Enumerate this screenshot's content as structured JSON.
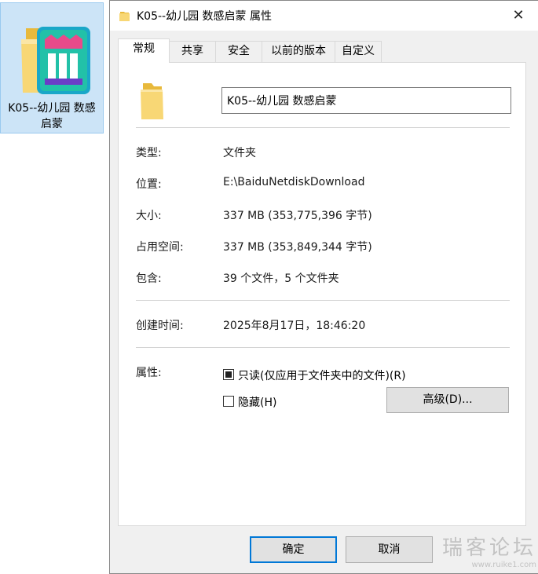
{
  "desktop_icon": {
    "label": "K05--幼儿园 数感启蒙"
  },
  "dialog": {
    "title": "K05--幼儿园 数感启蒙 属性",
    "close_glyph": "✕",
    "tabs": [
      {
        "label": "常规",
        "active": true
      },
      {
        "label": "共享",
        "active": false
      },
      {
        "label": "安全",
        "active": false
      },
      {
        "label": "以前的版本",
        "active": false
      },
      {
        "label": "自定义",
        "active": false
      }
    ],
    "name_value": "K05--幼儿园 数感启蒙",
    "props": {
      "type": {
        "label": "类型:",
        "value": "文件夹"
      },
      "location": {
        "label": "位置:",
        "value": "E:\\BaiduNetdiskDownload"
      },
      "size": {
        "label": "大小:",
        "value": "337 MB (353,775,396 字节)"
      },
      "disk_size": {
        "label": "占用空间:",
        "value": "337 MB (353,849,344 字节)"
      },
      "contains": {
        "label": "包含:",
        "value": "39 个文件，5 个文件夹"
      },
      "created": {
        "label": "创建时间:",
        "value": "2025年8月17日，18:46:20"
      },
      "attributes": {
        "label": "属性:"
      }
    },
    "readonly": {
      "label": "只读(仅应用于文件夹中的文件)(R)",
      "state": "indeterminate"
    },
    "hidden": {
      "label": "隐藏(H)",
      "state": "unchecked"
    },
    "advanced_button": "高级(D)...",
    "ok_button": "确定",
    "cancel_button": "取消"
  },
  "watermark": {
    "line1": "瑞客论坛",
    "line2": "www.ruike1.com"
  },
  "colors": {
    "accent": "#0078d7",
    "selection_bg": "#cce4f7",
    "folder": "#f8d775"
  },
  "icons": {
    "folder": "folder-icon",
    "close": "close-icon",
    "app": "app-logo-icon"
  }
}
